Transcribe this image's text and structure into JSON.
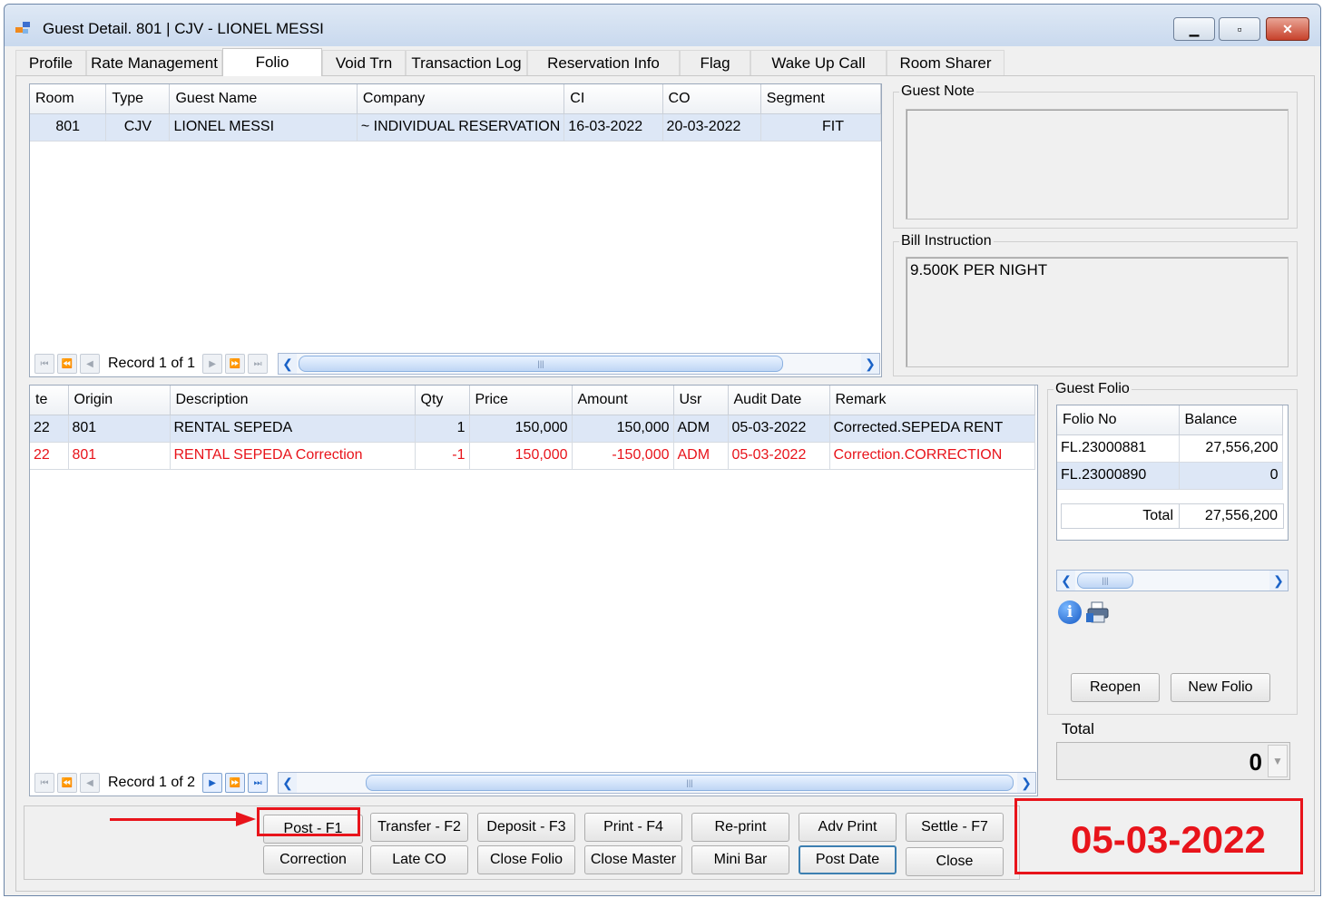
{
  "window": {
    "title": "Guest Detail. 801 | CJV - LIONEL MESSI",
    "minimize": "▁",
    "maximize": "▫",
    "close": "✕"
  },
  "tabs": [
    {
      "label": "Profile"
    },
    {
      "label": "Rate Management"
    },
    {
      "label": "Folio",
      "active": true
    },
    {
      "label": "Void Trn"
    },
    {
      "label": "Transaction Log"
    },
    {
      "label": "Reservation Info"
    },
    {
      "label": "Flag"
    },
    {
      "label": "Wake Up Call"
    },
    {
      "label": "Room Sharer"
    }
  ],
  "reservation_grid": {
    "columns": [
      "Room",
      "Type",
      "Guest Name",
      "Company",
      "CI",
      "CO",
      "Segment"
    ],
    "rows": [
      [
        "801",
        "CJV",
        "LIONEL MESSI",
        "~ INDIVIDUAL RESERVATION",
        "16-03-2022",
        "20-03-2022",
        "FIT"
      ]
    ],
    "record_text": "Record 1 of 1"
  },
  "guest_note": {
    "label": "Guest Note",
    "text": ""
  },
  "bill_instruction": {
    "label": "Bill Instruction",
    "text": "9.500K PER NIGHT"
  },
  "transaction_grid": {
    "columns": [
      "te",
      "Origin",
      "Description",
      "Qty",
      "Price",
      "Amount",
      "Usr",
      "Audit Date",
      "Remark"
    ],
    "rows": [
      [
        "22",
        "801",
        "RENTAL SEPEDA",
        "1",
        "150,000",
        "150,000",
        "ADM",
        "05-03-2022",
        "Corrected.SEPEDA RENT"
      ],
      [
        "22",
        "801",
        "RENTAL SEPEDA Correction",
        "-1",
        "150,000",
        "-150,000",
        "ADM",
        "05-03-2022",
        "Correction.CORRECTION"
      ]
    ],
    "record_text": "Record 1 of 2"
  },
  "guest_folio": {
    "label": "Guest Folio",
    "columns": [
      "Folio No",
      "Balance"
    ],
    "rows": [
      [
        "FL.23000881",
        "27,556,200"
      ],
      [
        "FL.23000890",
        "0"
      ]
    ],
    "total_label": "Total",
    "total_value": "27,556,200"
  },
  "folio_buttons": {
    "reopen": "Reopen",
    "new_folio": "New Folio"
  },
  "total": {
    "label": "Total",
    "value": "0"
  },
  "buttons": {
    "post": "Post - F1",
    "transfer": "Transfer - F2",
    "deposit": "Deposit - F3",
    "print": "Print - F4",
    "reprint": "Re-print",
    "adv_print": "Adv Print",
    "settle": "Settle - F7",
    "correction": "Correction",
    "late_co": "Late CO",
    "close_folio": "Close Folio",
    "close_master": "Close Master",
    "mini_bar": "Mini Bar",
    "post_date": "Post Date",
    "close": "Close"
  },
  "system_date": "05-03-2022",
  "colors": {
    "accent_red": "#e8141b",
    "selection": "#dde7f6"
  },
  "icons": [
    "info-icon",
    "printer-icon",
    "app-icon"
  ]
}
